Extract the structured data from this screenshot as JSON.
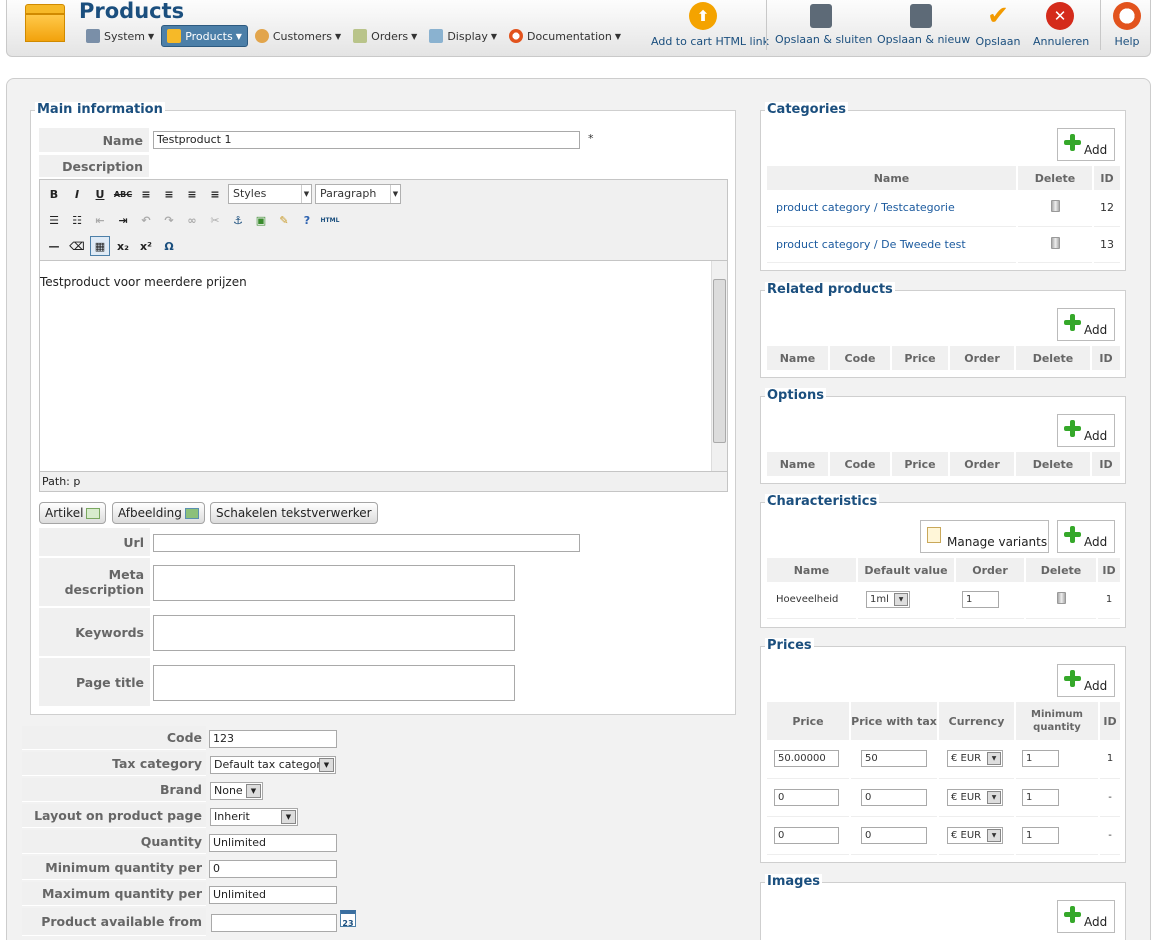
{
  "header": {
    "title": "Products",
    "menu": [
      {
        "label": "System",
        "icon": "tools-icon"
      },
      {
        "label": "Products",
        "icon": "box-icon"
      },
      {
        "label": "Customers",
        "icon": "users-icon"
      },
      {
        "label": "Orders",
        "icon": "orders-icon"
      },
      {
        "label": "Display",
        "icon": "display-icon"
      },
      {
        "label": "Documentation",
        "icon": "lifebuoy-icon"
      }
    ],
    "toolbar": {
      "cart_link": "Add to cart HTML link",
      "save_close": "Opslaan & sluiten",
      "save_new": "Opslaan & nieuw",
      "save": "Opslaan",
      "cancel": "Annuleren",
      "help": "Help"
    }
  },
  "main_info": {
    "legend": "Main information",
    "name_label": "Name",
    "name_value": "Testproduct 1",
    "required_mark": "*",
    "description_label": "Description",
    "editor": {
      "styles": "Styles",
      "paragraph": "Paragraph",
      "content": "Testproduct voor meerdere prijzen",
      "path": "Path: p",
      "html_btn": "HTML"
    },
    "buttons": {
      "artikel": "Artikel",
      "afbeelding": "Afbeelding",
      "toggle": "Schakelen tekstverwerker"
    },
    "url_label": "Url",
    "url_value": "",
    "meta_label": "Meta description",
    "keywords_label": "Keywords",
    "page_title_label": "Page title"
  },
  "details": {
    "code_label": "Code",
    "code_value": "123",
    "tax_label": "Tax category",
    "tax_value": "Default tax category",
    "brand_label": "Brand",
    "brand_value": "None",
    "layout_label": "Layout on product page",
    "layout_value": "Inherit",
    "quantity_label": "Quantity",
    "quantity_value": "Unlimited",
    "min_label": "Minimum quantity per order",
    "min_value": "0",
    "max_label": "Maximum quantity per order",
    "max_value": "Unlimited",
    "avail_label": "Product available from",
    "avail_value": "",
    "calendar_day": "23"
  },
  "categories": {
    "legend": "Categories",
    "add": "Add",
    "headers": [
      "Name",
      "Delete",
      "ID"
    ],
    "rows": [
      {
        "path": "product category / ",
        "name": "Testcategorie",
        "id": "12"
      },
      {
        "path": "product category / ",
        "name": "De Tweede test",
        "id": "13"
      }
    ]
  },
  "related": {
    "legend": "Related products",
    "add": "Add",
    "headers": [
      "Name",
      "Code",
      "Price",
      "Order",
      "Delete",
      "ID"
    ]
  },
  "options": {
    "legend": "Options",
    "add": "Add",
    "headers": [
      "Name",
      "Code",
      "Price",
      "Order",
      "Delete",
      "ID"
    ]
  },
  "characteristics": {
    "legend": "Characteristics",
    "manage": "Manage variants",
    "add": "Add",
    "headers": [
      "Name",
      "Default value",
      "Order",
      "Delete",
      "ID"
    ],
    "rows": [
      {
        "name": "Hoeveelheid",
        "default": "1ml",
        "order": "1",
        "id": "1"
      }
    ]
  },
  "prices": {
    "legend": "Prices",
    "add": "Add",
    "headers": [
      "Price",
      "Price with tax",
      "Currency",
      "Minimum quantity",
      "ID"
    ],
    "rows": [
      {
        "price": "50.00000",
        "tax": "50",
        "currency": "€ EUR",
        "min": "1",
        "id": "1"
      },
      {
        "price": "0",
        "tax": "0",
        "currency": "€ EUR",
        "min": "1",
        "id": "-"
      },
      {
        "price": "0",
        "tax": "0",
        "currency": "€ EUR",
        "min": "1",
        "id": "-"
      }
    ]
  },
  "images": {
    "legend": "Images",
    "add": "Add"
  },
  "colors": {
    "accent": "#1b4f7e",
    "menu_active": "#4c7fa8",
    "add_green": "#35a82a",
    "cancel_red": "#d42b1b",
    "cart_orange": "#f4a300"
  }
}
